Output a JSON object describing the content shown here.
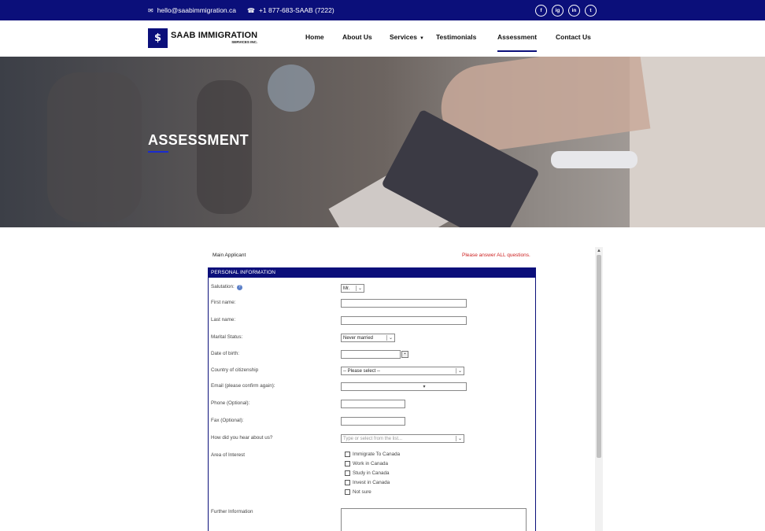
{
  "topbar": {
    "email": "hello@saabimmigration.ca",
    "phone": "+1 877-683-SAAB (7222)",
    "social": [
      "f",
      "ig",
      "in",
      "t"
    ]
  },
  "brand": {
    "mark": "$",
    "name": "SAAB IMMIGRATION",
    "sub": "SERVICES INC."
  },
  "nav": {
    "home": "Home",
    "about": "About Us",
    "services": "Services",
    "testimonials": "Testimonials",
    "assessment": "Assessment",
    "contact": "Contact Us"
  },
  "hero": {
    "title": "ASSESSMENT"
  },
  "form": {
    "main_applicant": "Main Applicant",
    "answer_all": "Please answer ALL questions.",
    "section_title": "PERSONAL INFORMATION",
    "salutation_label": "Salutation:",
    "salutation_value": "Mr.",
    "first_name_label": "First name:",
    "last_name_label": "Last name:",
    "marital_label": "Marital Status:",
    "marital_value": "Never married",
    "dob_label": "Date of birth:",
    "citizenship_label": "Country of citizenship",
    "citizenship_value": "-- Please select --",
    "email_label": "Email (please confirm again):",
    "phone_label": "Phone (Optional):",
    "fax_label": "Fax (Optional):",
    "hear_label": "How did you hear about us?",
    "hear_placeholder": "Type or select from the list...",
    "interest_label": "Area of Interest",
    "interests": [
      "Immigrate To Canada",
      "Work in Canada",
      "Study in Canada",
      "Invest in Canada",
      "Not sure"
    ],
    "further_label": "Further Information"
  }
}
